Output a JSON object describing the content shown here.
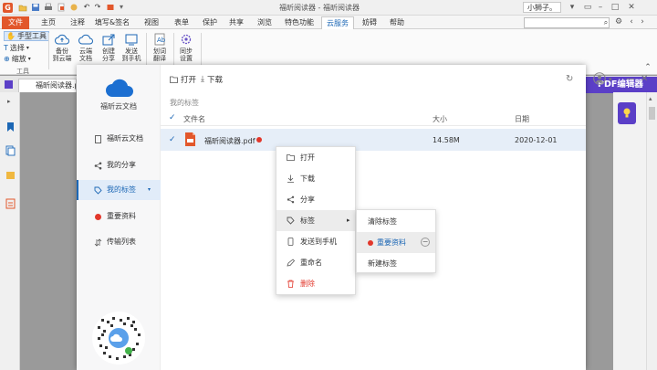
{
  "window": {
    "title": "福昕阅读器 - 福昕阅读器",
    "user": "小狮子。"
  },
  "menu": {
    "tabs": [
      "文件",
      "主页",
      "注释",
      "填写&签名",
      "视图",
      "表单",
      "保护",
      "共享",
      "浏览",
      "特色功能",
      "云服务",
      "帮助"
    ],
    "active_tab": "云服务",
    "extra_tab": "妨碍"
  },
  "ribbon": {
    "hand_tool": "手型工具",
    "select": "选择",
    "zoom": "缩放",
    "group_label": "工具",
    "buttons": [
      {
        "line1": "备份",
        "line2": "到云端",
        "icon": "cloud-upload-icon"
      },
      {
        "line1": "云端",
        "line2": "文档",
        "icon": "cloud-icon"
      },
      {
        "line1": "创建",
        "line2": "分享",
        "icon": "share-icon"
      },
      {
        "line1": "发送",
        "line2": "到手机",
        "icon": "phone-icon"
      },
      {
        "line1": "划词",
        "line2": "翻译",
        "icon": "translate-icon"
      },
      {
        "line1": "同步",
        "line2": "设置",
        "icon": "sync-settings-icon"
      }
    ]
  },
  "doc_tab": {
    "label": "福昕阅读器.pdf"
  },
  "pdf_editor": {
    "label": "PDF编辑器"
  },
  "cloud": {
    "app_name": "福昕云文档",
    "sidebar": [
      {
        "label": "福昕云文档",
        "icon": "document-icon"
      },
      {
        "label": "我的分享",
        "icon": "share-icon"
      },
      {
        "label": "我的标签",
        "icon": "tag-icon",
        "active": true
      },
      {
        "label": "重要资料",
        "icon": "red-dot-icon"
      },
      {
        "label": "传输列表",
        "icon": "transfer-icon"
      }
    ],
    "toolbar": {
      "open": "打开",
      "download": "下载"
    },
    "breadcrumb": "我的标签",
    "columns": {
      "name": "文件名",
      "size": "大小",
      "date": "日期"
    },
    "file": {
      "name": "福昕阅读器.pdf",
      "size": "14.58M",
      "date": "2020-12-01"
    }
  },
  "context_menu": {
    "items": [
      "打开",
      "下载",
      "分享",
      "标签",
      "发送到手机",
      "重命名",
      "删除"
    ],
    "hover_item": "标签"
  },
  "submenu": {
    "items": [
      "清除标签",
      "重要资料",
      "新建标签"
    ],
    "selected": "重要资料"
  },
  "colors": {
    "accent": "#1c67b5",
    "brand": "#e2572b",
    "tag_red": "#e2372b",
    "editor_purple": "#5b3fc7"
  }
}
